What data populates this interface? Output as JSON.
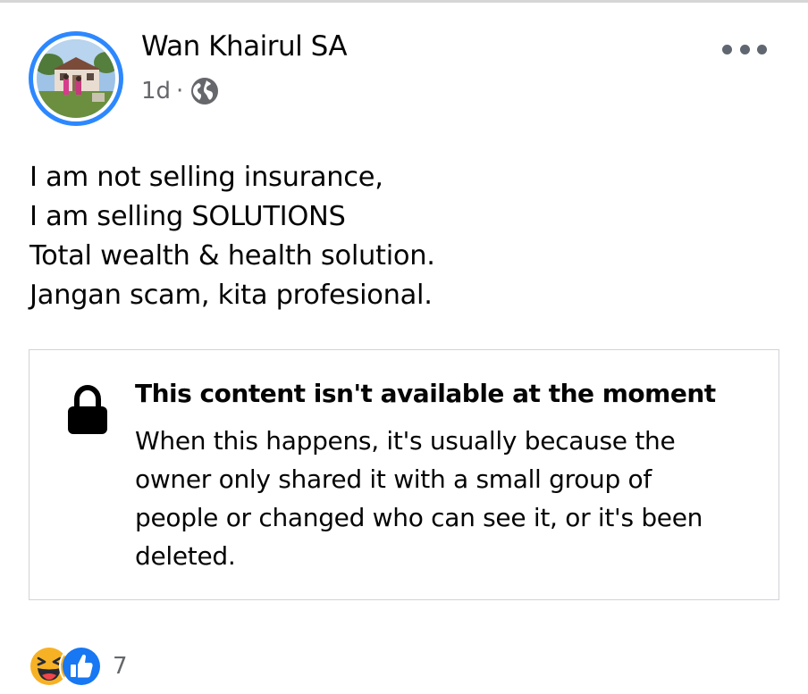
{
  "post": {
    "author": "Wan Khairul SA",
    "time": "1d",
    "separator": "·",
    "audience_icon": "globe-icon",
    "more_icon": "more-options-icon",
    "text_lines": [
      "I am not selling insurance,",
      "I am selling SOLUTIONS",
      "Total wealth & health solution.",
      "Jangan scam, kita profesional."
    ]
  },
  "unavailable": {
    "icon": "lock-icon",
    "title": "This content isn't available at the moment",
    "body_lines": [
      "When this happens, it's usually because the",
      "owner only shared it with a small group of",
      "people or changed who can see it, or it's been",
      "deleted."
    ]
  },
  "reactions": {
    "icons": [
      "haha-icon",
      "like-icon"
    ],
    "count": "7"
  },
  "colors": {
    "avatar_ring": "#2d88ff",
    "secondary_text": "#65676b",
    "like_blue": "#1877f2",
    "haha_yellow": "#f7b125"
  }
}
